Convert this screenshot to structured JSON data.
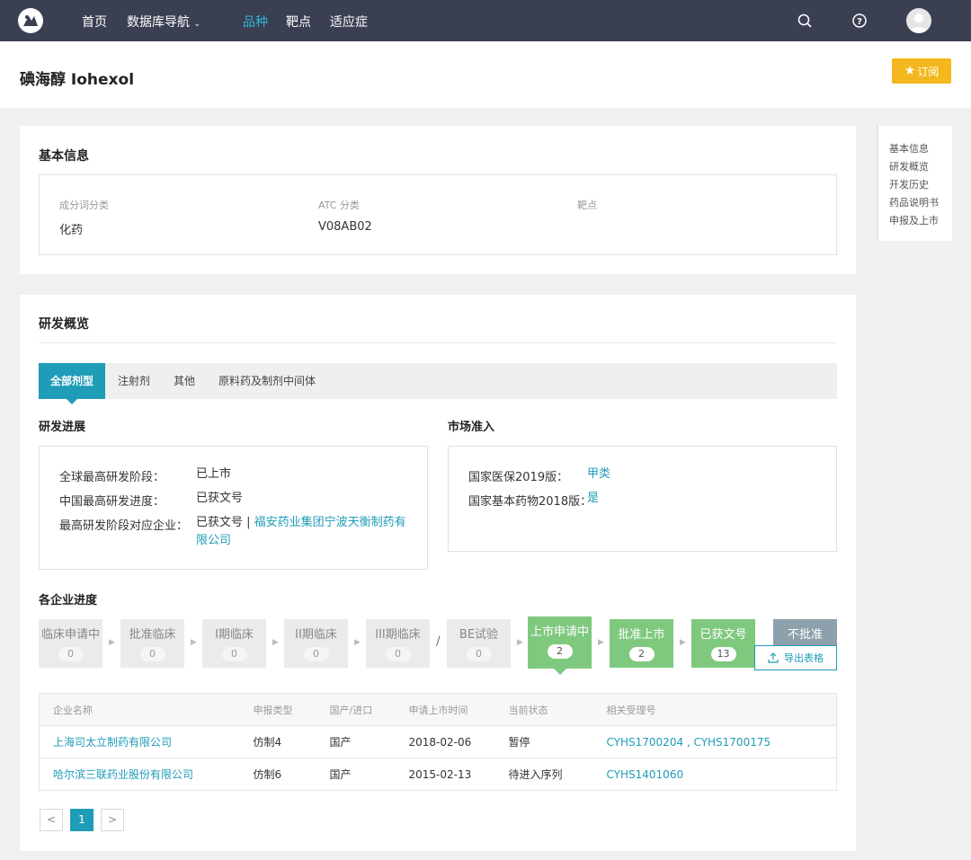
{
  "nav": {
    "items": [
      {
        "label": "首页"
      },
      {
        "label": "数据库导航"
      },
      {
        "label": "品种"
      },
      {
        "label": "靶点"
      },
      {
        "label": "适应症"
      }
    ]
  },
  "page": {
    "title": "碘海醇 Iohexol",
    "subscribe_label": "订阅"
  },
  "sidenav": {
    "items": [
      "基本信息",
      "研发概览",
      "开发历史",
      "药品说明书",
      "申报及上市"
    ]
  },
  "basic_info": {
    "title": "基本信息",
    "fields": [
      {
        "label": "成分词分类",
        "value": "化药"
      },
      {
        "label": "ATC 分类",
        "value": "V08AB02"
      },
      {
        "label": "靶点",
        "value": ""
      }
    ]
  },
  "rd_overview": {
    "title": "研发概览",
    "tabs": [
      "全部剂型",
      "注射剂",
      "其他",
      "原料药及制剂中间体"
    ],
    "progress": {
      "title": "研发进展",
      "rows": [
        {
          "label": "全球最高研发阶段：",
          "value": "已上市"
        },
        {
          "label": "中国最高研发进度：",
          "value": "已获文号"
        },
        {
          "label": "最高研发阶段对应企业：",
          "value": "已获文号",
          "sep": " | ",
          "link": "福安药业集团宁波天衡制药有限公司"
        }
      ]
    },
    "market": {
      "title": "市场准入",
      "rows": [
        {
          "label": "国家医保2019版：",
          "value": "甲类"
        },
        {
          "label": "国家基本药物2018版：",
          "value": "是"
        }
      ]
    }
  },
  "enterprise": {
    "title": "各企业进度",
    "stages": [
      {
        "label": "临床申请中",
        "count": "0"
      },
      {
        "label": "批准临床",
        "count": "0"
      },
      {
        "label": "I期临床",
        "count": "0"
      },
      {
        "label": "II期临床",
        "count": "0"
      },
      {
        "label": "III期临床",
        "count": "0"
      },
      {
        "label": "BE试验",
        "count": "0"
      },
      {
        "label": "上市申请中",
        "count": "2"
      },
      {
        "label": "批准上市",
        "count": "2"
      },
      {
        "label": "已获文号",
        "count": "13"
      },
      {
        "label": "不批准",
        "count": ""
      }
    ],
    "slash": "/",
    "export_label": "导出表格",
    "columns": [
      "企业名称",
      "申报类型",
      "国产/进口",
      "申请上市时间",
      "当前状态",
      "相关受理号"
    ],
    "rows": [
      {
        "company": "上海司太立制药有限公司",
        "type": "仿制4",
        "origin": "国产",
        "date": "2018-02-06",
        "status": "暂停",
        "numbers": "CYHS1700204 , CYHS1700175"
      },
      {
        "company": "哈尔滨三联药业股份有限公司",
        "type": "仿制6",
        "origin": "国产",
        "date": "2015-02-13",
        "status": "待进入序列",
        "numbers": "CYHS1401060"
      }
    ],
    "pagination": {
      "prev": "<",
      "current": "1",
      "next": ">"
    }
  }
}
